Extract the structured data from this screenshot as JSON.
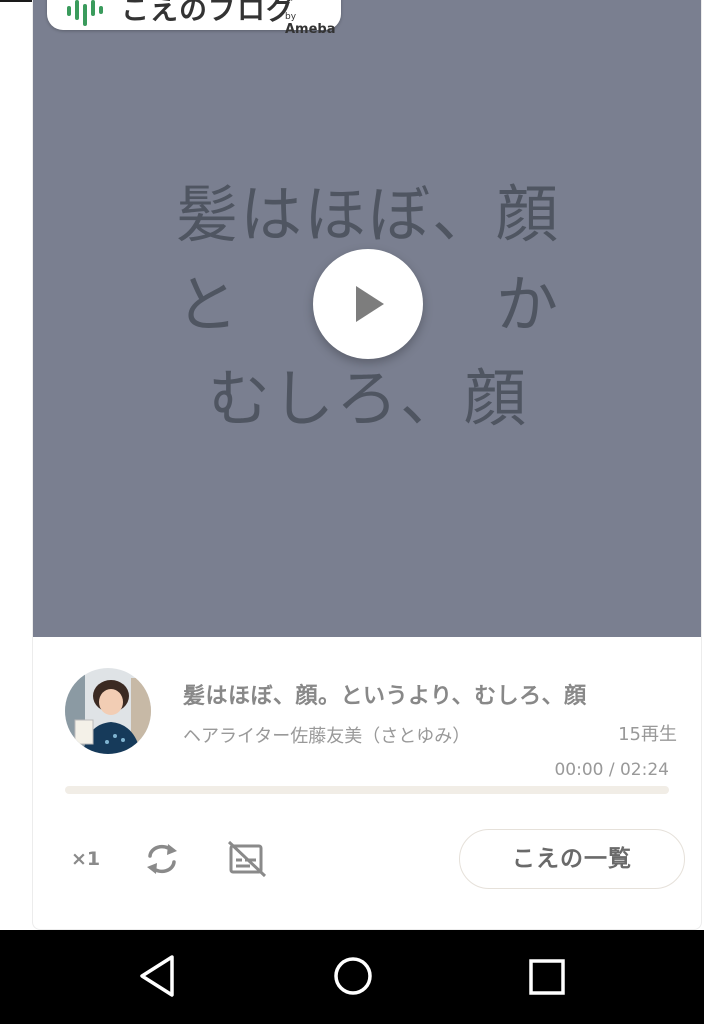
{
  "logo": {
    "main_text": "こえのブログ",
    "by_text": "by",
    "brand_text": "Ameba",
    "icon": "voice-wave-logo-icon"
  },
  "video": {
    "overlay_lines": [
      "髪はほぼ、顔",
      "と　　　　か",
      "むしろ、顔"
    ],
    "play_icon": "play-icon",
    "background_color": "#7a7f90"
  },
  "player": {
    "title": "髪はほぼ、顔。というより、むしろ、顔",
    "author": "ヘアライター佐藤友美（さとゆみ）",
    "play_count": "15再生",
    "time": "00:00 / 02:24",
    "progress_fraction": 0,
    "speed_label": "×1",
    "repeat_icon": "repeat-icon",
    "subtitles_icon": "subtitles-off-icon",
    "list_button_label": "こえの一覧"
  },
  "navbar": {
    "back_icon": "back-triangle-icon",
    "home_icon": "home-circle-icon",
    "recent_icon": "recent-apps-square-icon"
  }
}
